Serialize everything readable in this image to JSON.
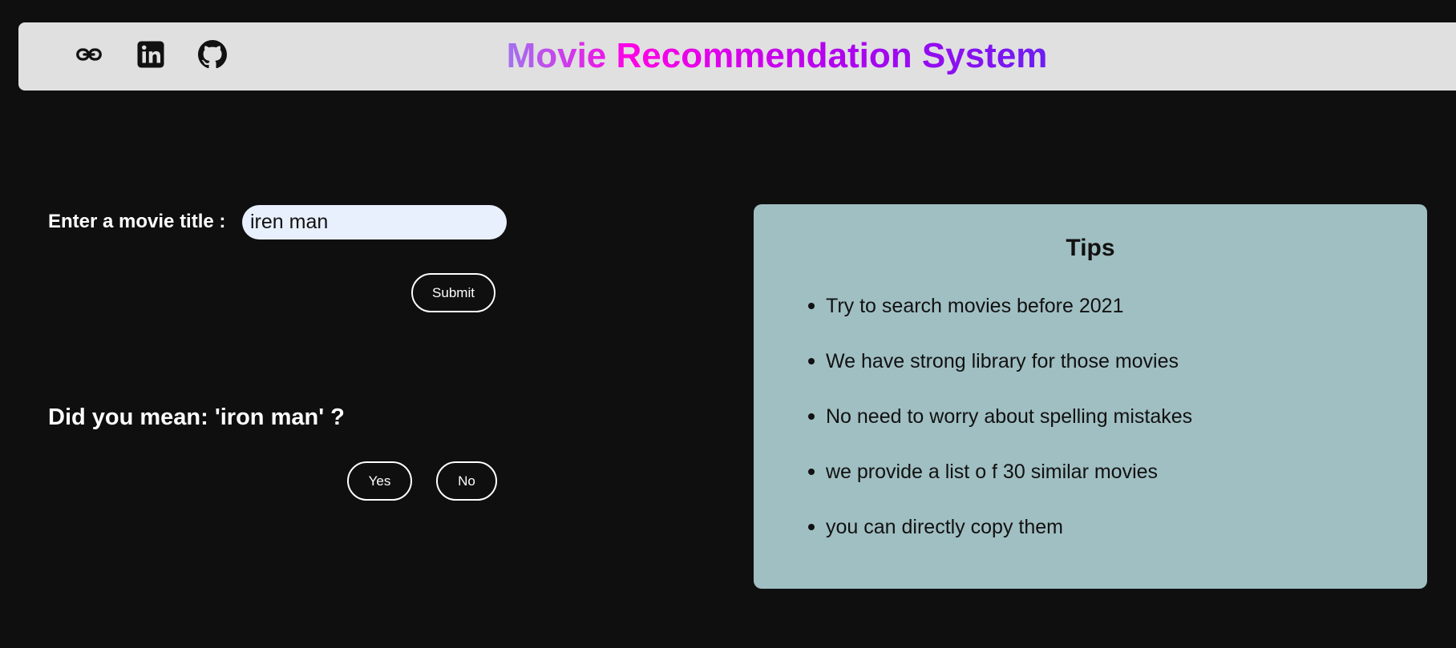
{
  "header": {
    "title": "Movie Recommendation System",
    "icons": [
      "link-icon",
      "linkedin-icon",
      "github-icon"
    ]
  },
  "search": {
    "label": "Enter a movie title :",
    "value": "iren man",
    "submit_label": "Submit"
  },
  "suggestion": {
    "question": "Did you mean: 'iron man' ?",
    "yes_label": "Yes",
    "no_label": "No"
  },
  "tips": {
    "title": "Tips",
    "items": [
      "Try to search movies before 2021",
      "We have strong library for those movies",
      "No need to worry about spelling mistakes",
      "we provide a list o f 30 similar movies",
      "you can directly copy them"
    ]
  },
  "colors": {
    "background": "#0f0f0f",
    "header_bg": "#e0e0e0",
    "tips_bg": "#a0bfc2",
    "title_gradient": [
      "#9a7cf0",
      "#ff00e6",
      "#b300f0",
      "#6a1ef2"
    ]
  }
}
